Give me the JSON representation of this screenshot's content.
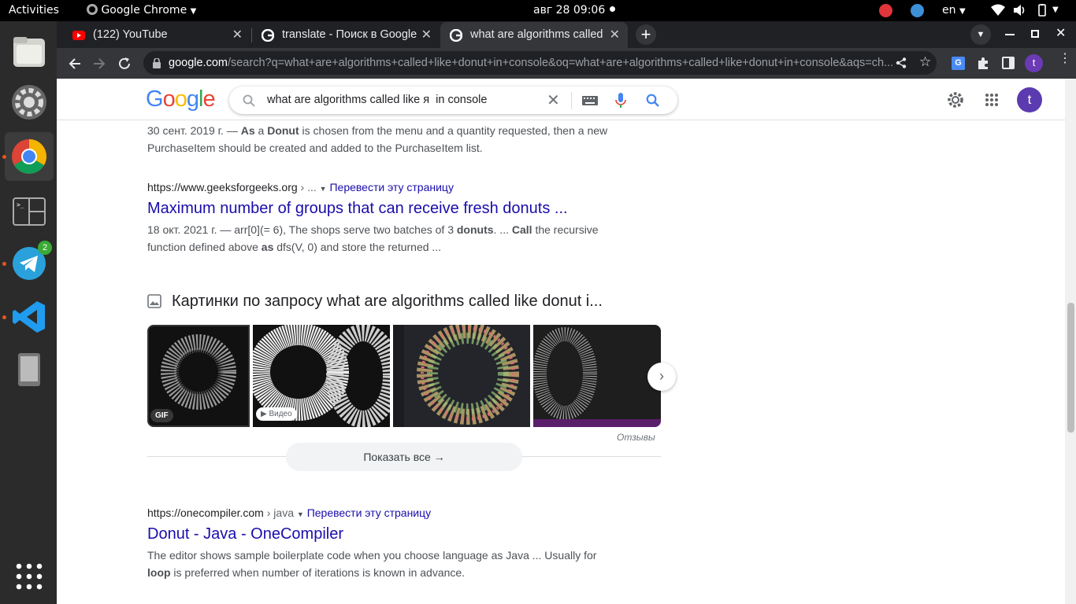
{
  "topbar": {
    "activities": "Activities",
    "app": "Google Chrome",
    "datetime": "авг 28  09:06",
    "lang": "en"
  },
  "dock": {
    "telegram_badge": "2"
  },
  "tabs": [
    {
      "title": "(122) YouTube"
    },
    {
      "title": "translate - Поиск в Google"
    },
    {
      "title": "what are algorithms called"
    }
  ],
  "address": {
    "domain": "google.com",
    "path": "/search?q=what+are+algorithms+called+like+donut+in+console&oq=what+are+algorithms+called+like+donut+in+console&aqs=ch..."
  },
  "profile_letter": "t",
  "search": {
    "query": "what are algorithms called like я  in console",
    "logo": "Google"
  },
  "results": {
    "r0": {
      "snippet_pre": "30 сент. 2019 г. — ",
      "b1": "As",
      "t1": " a ",
      "b2": "Donut",
      "t2": " is chosen from the menu and a quantity requested, then a new PurchaseItem should be created and added to the PurchaseItem list."
    },
    "r1": {
      "url": "https://www.geeksforgeeks.org",
      "url_tail": " › ...",
      "translate": "Перевести эту страницу",
      "title": "Maximum number of groups that can receive fresh donuts ...",
      "s1": "18 окт. 2021 г. — arr[0](= 6), The shops serve two batches of 3 ",
      "b1": "donuts",
      "s2": ". ... ",
      "b2": "Call",
      "s3": " the recursive function defined above ",
      "b3": "as",
      "s4": " dfs(V, 0) and store the returned ..."
    },
    "images": {
      "heading": "Картинки по запросу what are algorithms called like donut i...",
      "gif": "GIF",
      "video": "▶ Видео",
      "feedback": "Отзывы",
      "show_all": "Показать все"
    },
    "r2": {
      "url": "https://onecompiler.com",
      "url_tail": " › java",
      "translate": "Перевести эту страницу",
      "title": "Donut - Java - OneCompiler",
      "s1": "The editor shows sample boilerplate code when you choose language as Java ... Usually for ",
      "b1": "loop",
      "s2": " is preferred when number of iterations is known in advance."
    }
  }
}
